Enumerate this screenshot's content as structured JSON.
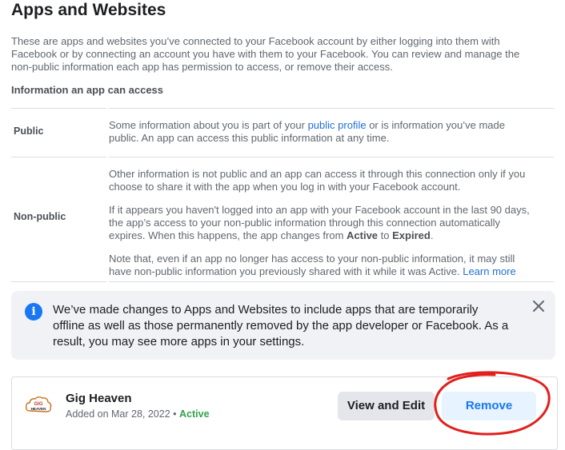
{
  "page": {
    "title": "Apps and Websites",
    "intro_lines": [
      "These are apps and websites you’ve connected to your Facebook account by either logging into them with",
      "Facebook or by connecting an account you have with them to your Facebook. You can review and manage the",
      "non-public information each app has permission to access, or remove their access."
    ],
    "access_heading": "Information an app can access"
  },
  "access_table": {
    "public": {
      "label": "Public",
      "line1_pre": "Some information about you is part of your ",
      "line1_link": "public profile",
      "line1_post": " or is information you’ve made",
      "line2": "public. An app can access this public information at any time."
    },
    "nonpublic": {
      "label": "Non-public",
      "p1_lines": [
        "Other information is not public and an app can access it through this connection only if you",
        "choose to share it with the app when you log in with your Facebook account."
      ],
      "p2_lines": [
        "If it appears you haven't logged into an app with your Facebook account in the last 90 days,",
        "the app’s access to your non-public information through this connection automatically"
      ],
      "p2_line3_pre": "expires. When this happens, the app changes from ",
      "p2_line3_active": "Active",
      "p2_line3_mid": " to ",
      "p2_line3_expired": "Expired",
      "p2_line3_post": ".",
      "p3_line1": "Note that, even if an app no longer has access to your non-public information, it may still",
      "p3_line2_pre": "have non-public information you previously shared with it while it was Active. ",
      "p3_line2_link": "Learn more"
    }
  },
  "notice": {
    "icon": "info-icon",
    "icon_glyph": "i",
    "lines": [
      "We’ve made changes to Apps and Websites to include apps that are temporarily",
      "offline as well as those permanently removed by the app developer or Facebook. As a",
      "result, you may see more apps in your settings."
    ],
    "close_icon": "close-icon"
  },
  "app": {
    "name": "Gig Heaven",
    "logo_text_top": "GIG",
    "logo_text_bottom": "HEAVEN",
    "added_text": "Added on Mar 28, 2022",
    "separator": "•",
    "status": "Active",
    "view_edit_label": "View and Edit",
    "remove_label": "Remove"
  },
  "colors": {
    "link": "#216fdb",
    "primary": "#1877f2",
    "active_green": "#31a24c",
    "annotation_red": "#e0201c"
  }
}
